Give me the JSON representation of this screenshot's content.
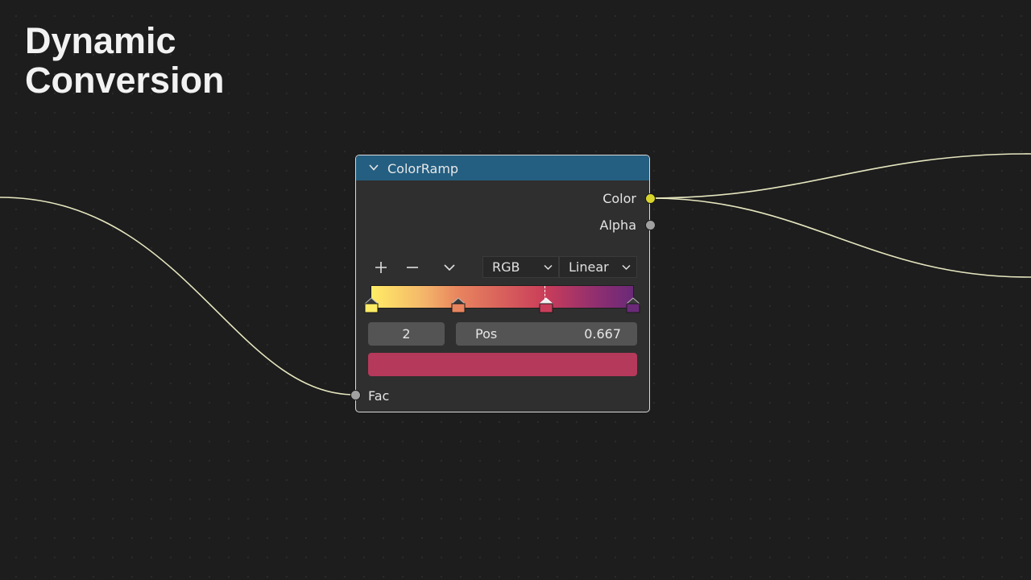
{
  "title": {
    "line1": "Dynamic",
    "line2": "Conversion"
  },
  "node": {
    "title": "ColorRamp",
    "outputs": [
      {
        "label": "Color",
        "socket_color": "#d8d42e"
      },
      {
        "label": "Alpha",
        "socket_color": "#a1a1a1"
      }
    ],
    "input": {
      "label": "Fac",
      "socket_color": "#a1a1a1"
    },
    "toolbar": {
      "add_icon": "plus-icon",
      "remove_icon": "minus-icon",
      "menu_icon": "chevron-down-icon"
    },
    "color_mode": "RGB",
    "interpolation": "Linear",
    "ramp": {
      "stops": [
        {
          "position": 0.0,
          "color": "#ffec66"
        },
        {
          "position": 0.333,
          "color": "#e8845e"
        },
        {
          "position": 0.667,
          "color": "#c93d5a"
        },
        {
          "position": 1.0,
          "color": "#6a2a78"
        }
      ]
    },
    "active_index": "2",
    "pos_label": "Pos",
    "pos_value": "0.667",
    "active_color": "#b5395a"
  },
  "colors": {
    "header": "#245e80",
    "wire": "#e6e6c0",
    "background": "#1d1d1d"
  }
}
